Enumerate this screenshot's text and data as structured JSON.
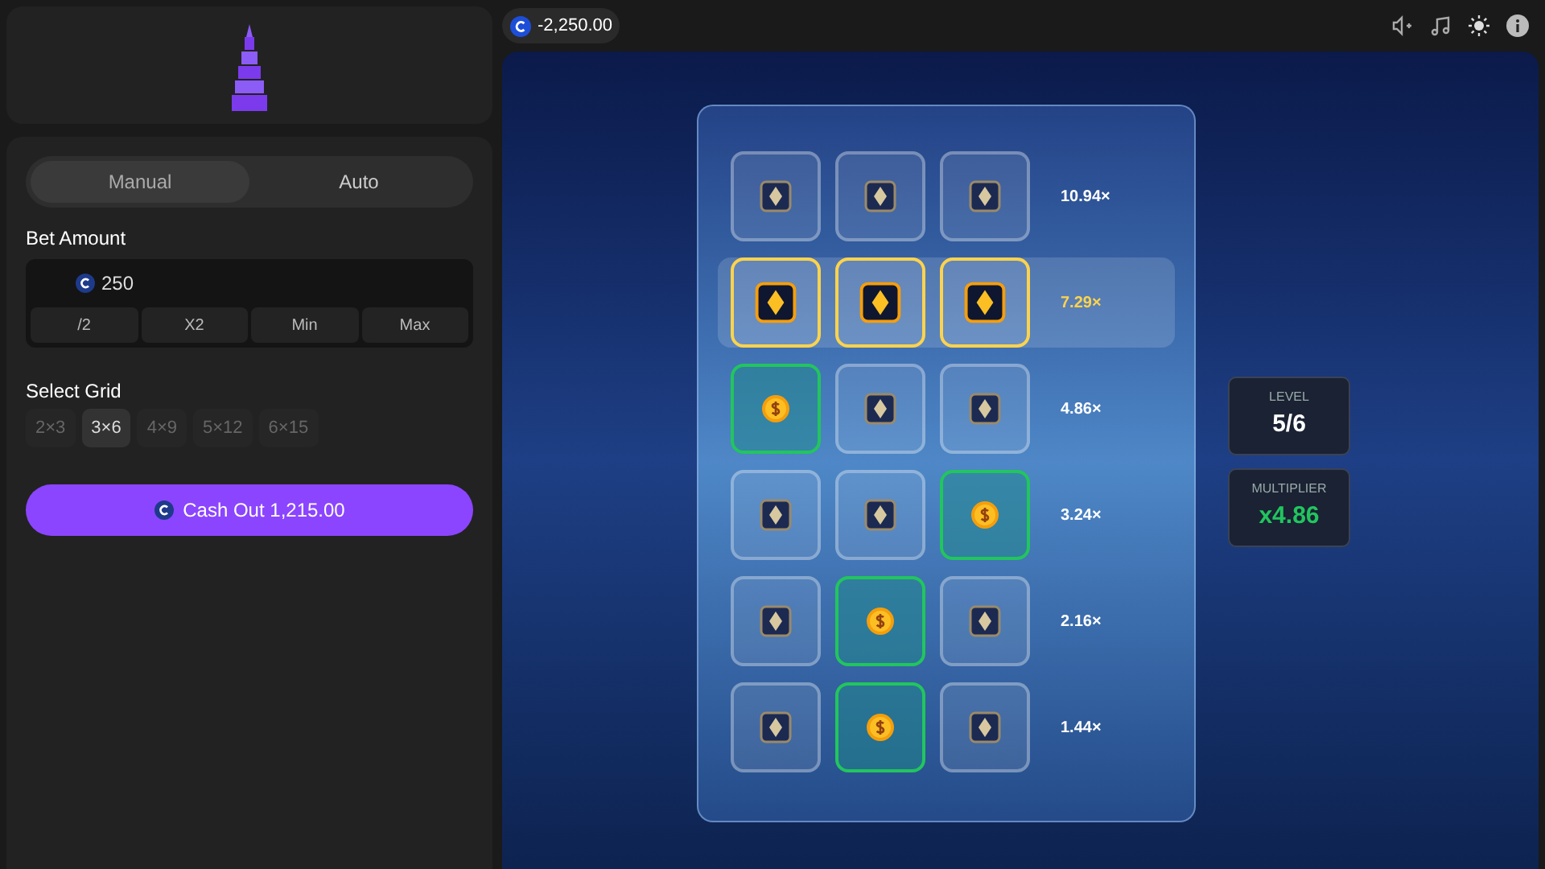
{
  "balance": "-2,250.00",
  "modes": [
    {
      "label": "Manual",
      "selected": true
    },
    {
      "label": "Auto",
      "selected": false
    }
  ],
  "bet": {
    "label": "Bet Amount",
    "value": "250",
    "buttons": [
      "/2",
      "X2",
      "Min",
      "Max"
    ]
  },
  "grid_select": {
    "label": "Select Grid",
    "options": [
      {
        "label": "2×3",
        "selected": false
      },
      {
        "label": "3×6",
        "selected": true
      },
      {
        "label": "4×9",
        "selected": false
      },
      {
        "label": "5×12",
        "selected": false
      },
      {
        "label": "6×15",
        "selected": false
      }
    ]
  },
  "cash_out": "Cash Out 1,215.00",
  "rows": [
    {
      "multiplier": "10.94×",
      "current": false,
      "cells": [
        {
          "kind": "gem"
        },
        {
          "kind": "gem"
        },
        {
          "kind": "gem"
        }
      ]
    },
    {
      "multiplier": "7.29×",
      "current": true,
      "cells": [
        {
          "kind": "gem"
        },
        {
          "kind": "gem"
        },
        {
          "kind": "gem"
        }
      ]
    },
    {
      "multiplier": "4.86×",
      "current": false,
      "cells": [
        {
          "kind": "coin"
        },
        {
          "kind": "gem"
        },
        {
          "kind": "gem"
        }
      ]
    },
    {
      "multiplier": "3.24×",
      "current": false,
      "cells": [
        {
          "kind": "gem"
        },
        {
          "kind": "gem"
        },
        {
          "kind": "coin"
        }
      ]
    },
    {
      "multiplier": "2.16×",
      "current": false,
      "cells": [
        {
          "kind": "gem"
        },
        {
          "kind": "coin"
        },
        {
          "kind": "gem"
        }
      ]
    },
    {
      "multiplier": "1.44×",
      "current": false,
      "cells": [
        {
          "kind": "gem"
        },
        {
          "kind": "coin"
        },
        {
          "kind": "gem"
        }
      ]
    }
  ],
  "stats": [
    {
      "label": "LEVEL",
      "value": "5/6",
      "kind": "plain"
    },
    {
      "label": "MULTIPLIER",
      "value": "x4.86",
      "kind": "accent"
    }
  ]
}
